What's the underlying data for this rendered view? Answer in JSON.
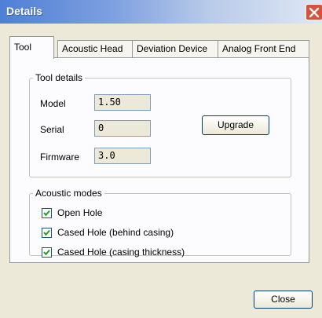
{
  "window": {
    "title": "Details"
  },
  "tabs": [
    {
      "label": "Tool",
      "selected": true
    },
    {
      "label": "Acoustic Head",
      "selected": false
    },
    {
      "label": "Deviation Device",
      "selected": false
    },
    {
      "label": "Analog Front End",
      "selected": false
    }
  ],
  "tool_details": {
    "legend": "Tool details",
    "model": {
      "label": "Model",
      "value": "1.50"
    },
    "serial": {
      "label": "Serial",
      "value": "0"
    },
    "firmware": {
      "label": "Firmware",
      "value": "3.0"
    },
    "upgrade_label": "Upgrade"
  },
  "acoustic_modes": {
    "legend": "Acoustic modes",
    "options": [
      {
        "label": "Open Hole",
        "checked": true
      },
      {
        "label": "Cased Hole (behind casing)",
        "checked": true
      },
      {
        "label": "Cased Hole (casing thickness)",
        "checked": true
      }
    ]
  },
  "footer": {
    "close_label": "Close"
  },
  "colors": {
    "title_bar": "#4f7fd6",
    "close_button": "#d8513a",
    "dialog_face": "#ece9d8"
  },
  "icons": {
    "close": "close-icon",
    "check": "checkmark-icon"
  }
}
